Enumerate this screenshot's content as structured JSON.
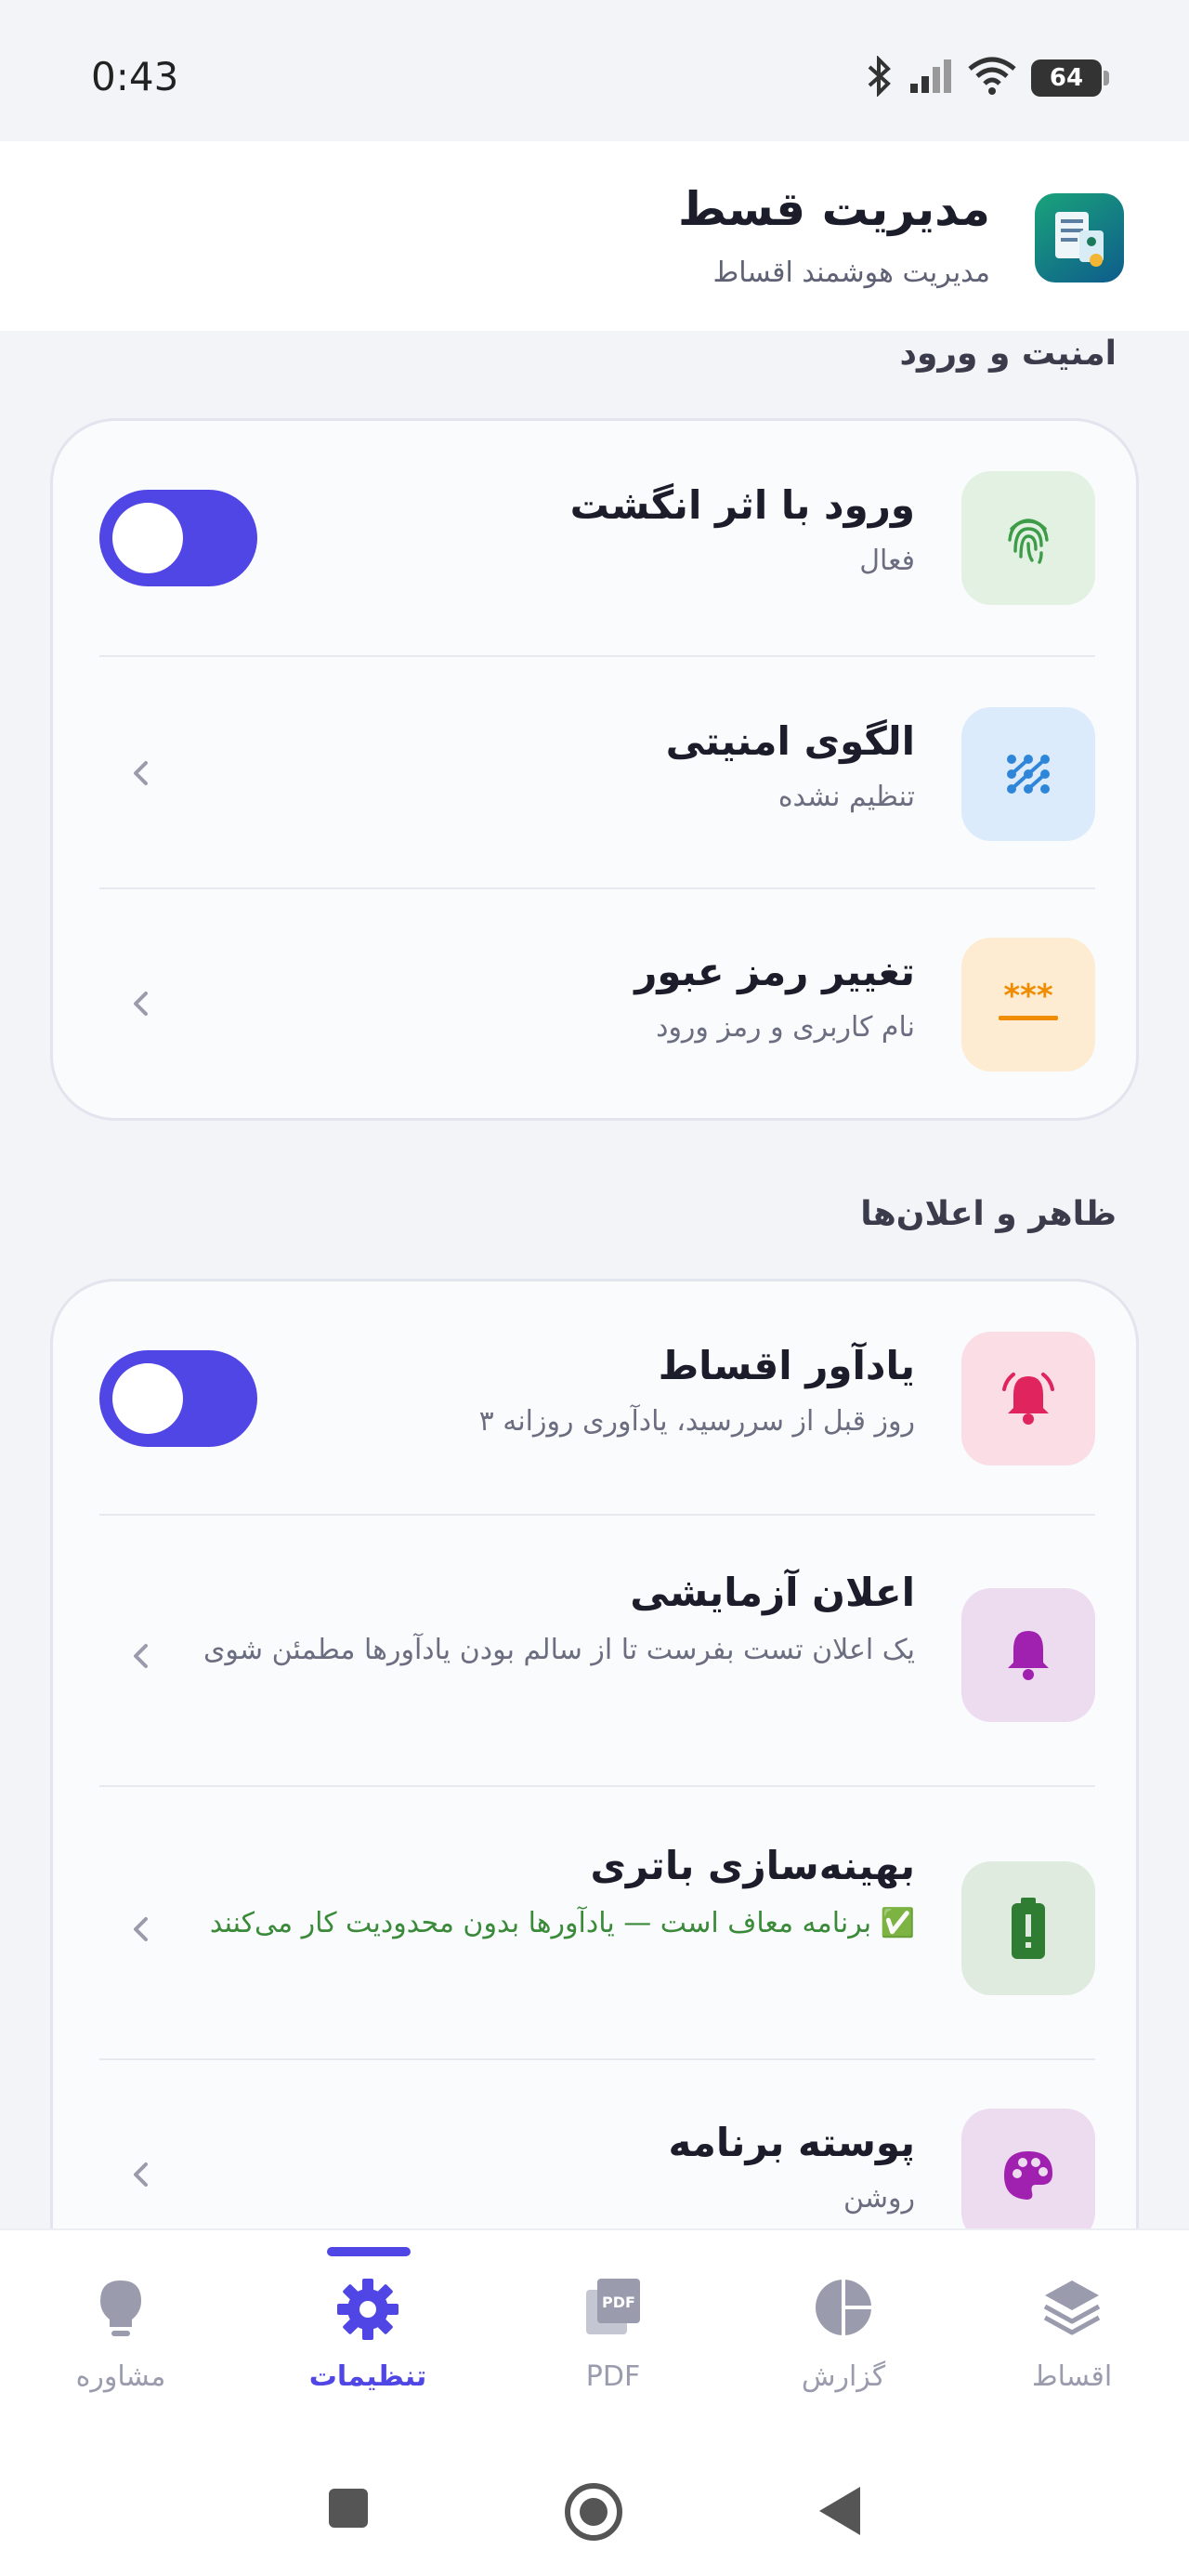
{
  "status_bar": {
    "time": "0:43",
    "battery": "64"
  },
  "header": {
    "title": "مدیریت قسط",
    "subtitle": "مدیریت هوشمند اقساط"
  },
  "sections": {
    "security": {
      "title": "امنیت و ورود",
      "items": [
        {
          "title": "ورود با اثر انگشت",
          "subtitle": "فعال",
          "toggle_on": true
        },
        {
          "title": "الگوی امنیتی",
          "subtitle": "تنظیم نشده"
        },
        {
          "title": "تغییر رمز عبور",
          "subtitle": "نام کاربری و رمز ورود"
        }
      ]
    },
    "appearance": {
      "title": "ظاهر و اعلان‌ها",
      "items": [
        {
          "title": "یادآور اقساط",
          "subtitle": "۳ روز قبل از سررسید، یادآوری روزانه",
          "toggle_on": true
        },
        {
          "title": "اعلان آزمایشی",
          "subtitle": "یک اعلان تست بفرست تا از سالم بودن یادآورها مطمئن شوی"
        },
        {
          "title": "بهینه‌سازی باتری",
          "subtitle": "برنامه معاف است — یادآورها بدون محدودیت کار می‌کنند ✅"
        },
        {
          "title": "پوسته برنامه",
          "subtitle": "روشن"
        }
      ]
    }
  },
  "nav": {
    "items": [
      {
        "label": "مشاوره",
        "icon": "lightbulb-icon"
      },
      {
        "label": "تنظیمات",
        "icon": "gear-icon",
        "active": true
      },
      {
        "label": "PDF",
        "icon": "pdf-icon"
      },
      {
        "label": "گزارش",
        "icon": "pie-chart-icon"
      },
      {
        "label": "اقساط",
        "icon": "layers-icon"
      }
    ]
  },
  "colors": {
    "accent": "#4f46e5",
    "fingerprint_bg": "#e3f1e3",
    "pattern_bg": "#dcebfb",
    "password_bg": "#fdebd2",
    "reminder_bg": "#fbdde6",
    "test_notif_bg": "#eddcf0",
    "battery_bg": "#e0ebe0",
    "theme_bg": "#eddcf0"
  }
}
